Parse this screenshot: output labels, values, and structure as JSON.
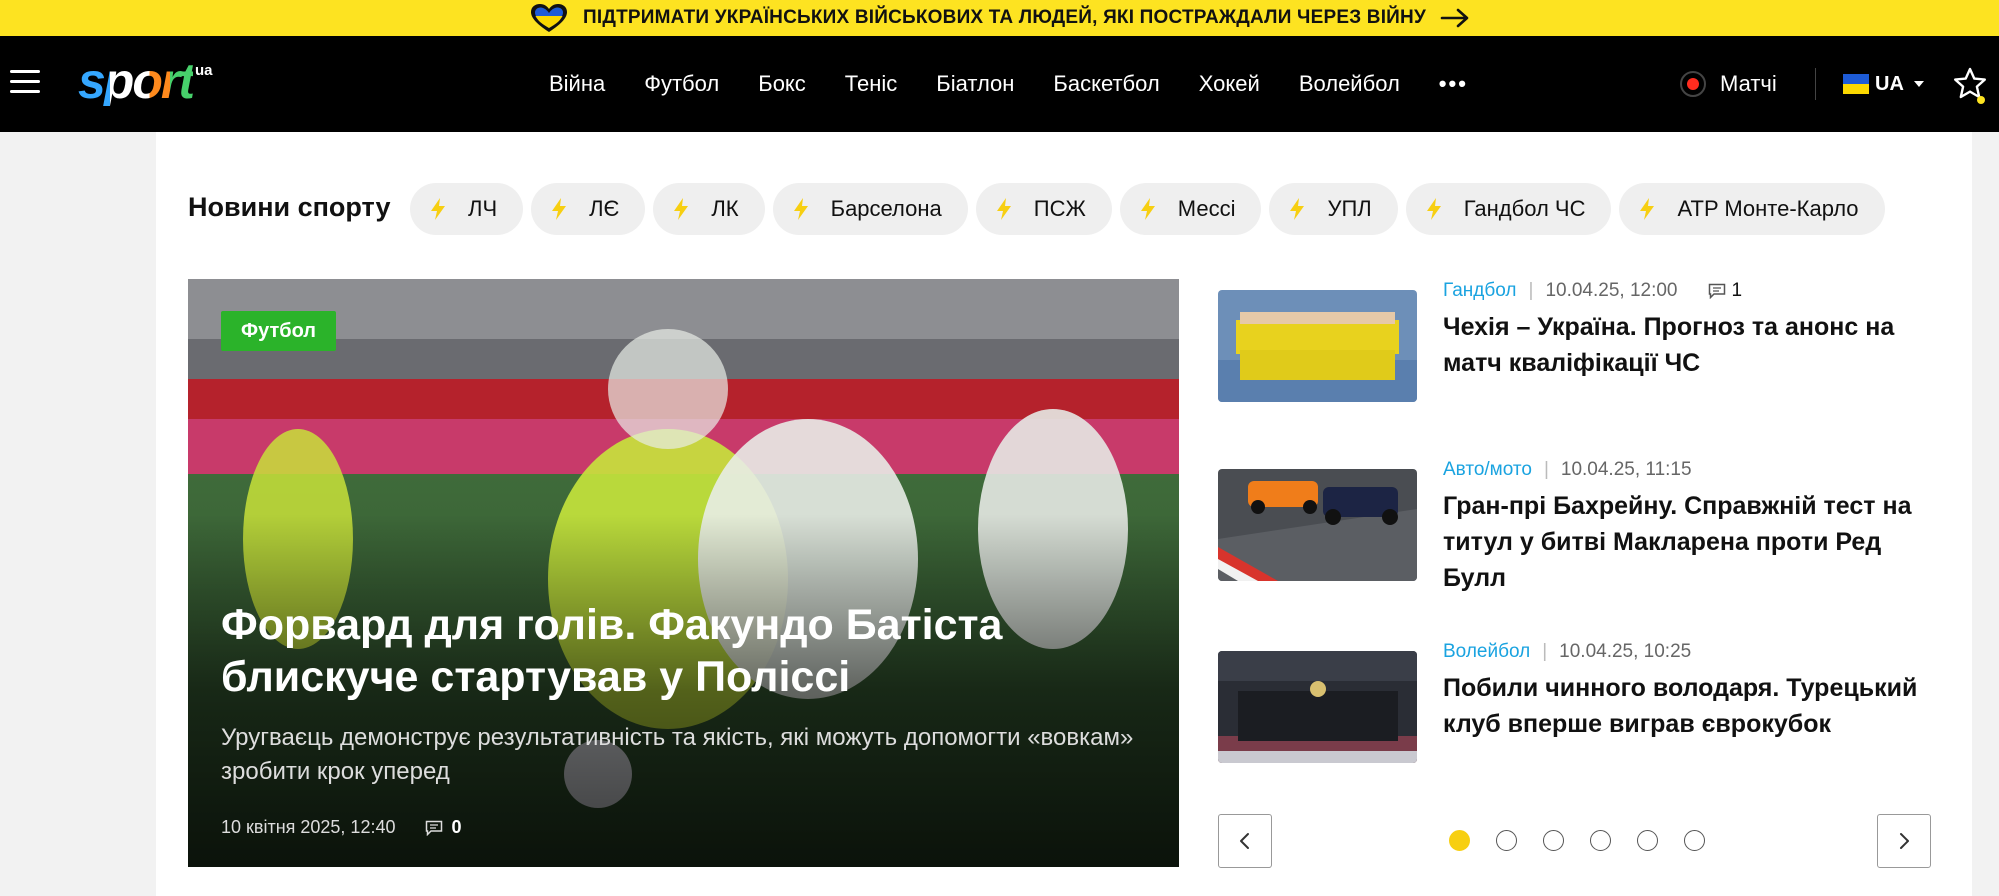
{
  "banner": {
    "text": "ПІДТРИМАТИ УКРАЇНСЬКИХ ВІЙСЬКОВИХ ТА ЛЮДЕЙ, ЯКІ ПОСТРАЖДАЛИ ЧЕРЕЗ ВІЙНУ",
    "icon": "heart-icon",
    "arrow_icon": "arrow-right-icon"
  },
  "header": {
    "logo": {
      "main": "sport",
      "suffix": "ua"
    },
    "nav": [
      "Війна",
      "Футбол",
      "Бокс",
      "Теніс",
      "Біатлон",
      "Баскетбол",
      "Хокей",
      "Волейбол"
    ],
    "more": "•••",
    "matches": "Матчі",
    "lang": "UA",
    "colors": {
      "background": "#000000",
      "live": "#ff2c1f",
      "flag_top": "#1d5bd6",
      "flag_bottom": "#fbd800"
    }
  },
  "news": {
    "title": "Новини спорту",
    "tags": [
      "ЛЧ",
      "ЛЄ",
      "ЛК",
      "Барселона",
      "ПСЖ",
      "Мессі",
      "УПЛ",
      "Гандбол ЧС",
      "ATP Монте-Карло"
    ]
  },
  "hero": {
    "badge": "Футбол",
    "title": "Форвард для голів. Факундо Батіста блискуче стартував у Поліссі",
    "lead": "Уругваєць демонструє результативність та якість, які можуть допомогти «вовкам» зробити крок уперед",
    "date": "10 квітня 2025, 12:40",
    "comments": "0"
  },
  "items": [
    {
      "category": "Гандбол",
      "time": "10.04.25, 12:00",
      "comments": "1",
      "title": "Чехія – Україна. Прогноз та анонс на матч кваліфікації ЧС"
    },
    {
      "category": "Авто/мото",
      "time": "10.04.25, 11:15",
      "title": "Гран-прі Бахрейну. Справжній тест на титул у битві Макларена проти Ред Булл"
    },
    {
      "category": "Волейбол",
      "time": "10.04.25, 10:25",
      "title": "Побили чинного володаря. Турецький клуб вперше виграв єврокубок"
    }
  ],
  "slider": {
    "pages": 6,
    "active_index": 0,
    "prev_icon": "chevron-left-icon",
    "next_icon": "chevron-right-icon",
    "accent": "#f7cf11"
  }
}
